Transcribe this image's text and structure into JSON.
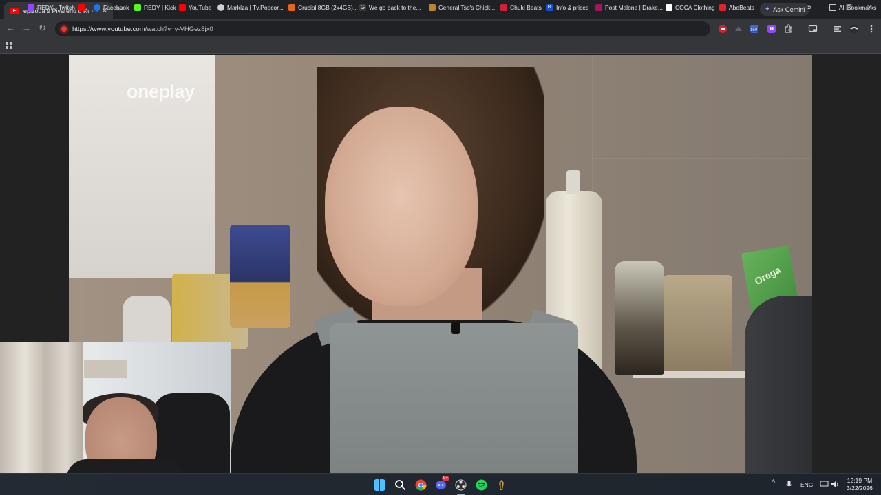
{
  "browser": {
    "tab": {
      "title": "epizóda 9 Piváreňu u Kultúr",
      "close": "✕"
    },
    "new_tab": "+",
    "ask_gemini": "Ask Gemini",
    "window_controls": {
      "minimize": "—",
      "restore": "❐",
      "close": "✕"
    },
    "nav": {
      "back": "←",
      "forward": "→",
      "reload": "↻"
    },
    "url_host": "https://www.youtube.com",
    "url_path": "/watch?v=y-VHGez8jx0",
    "extension_badge": "150"
  },
  "bookmarks": {
    "items": [
      {
        "label": "REDY - Twitch",
        "color": "#9146ff"
      },
      {
        "label": "",
        "color": "#ff0000"
      },
      {
        "label": "Facebook",
        "color": "#1877f2"
      },
      {
        "label": "REDY | Kick",
        "color": "#53fc18"
      },
      {
        "label": "YouTube",
        "color": "#ff0000"
      },
      {
        "label": "Markíza | Tv.Popcor...",
        "color": "#cfcfcf"
      },
      {
        "label": "Crucial 8GB (2x4GB)...",
        "color": "#e8641b"
      },
      {
        "label": "We go back to the...",
        "color": "#3a3a3a"
      },
      {
        "label": "General Tso's Chick...",
        "color": "#b8862c"
      },
      {
        "label": "Chuki Beats",
        "color": "#d11f3a"
      },
      {
        "label": "Info & prices",
        "color": "#1a4fd1"
      },
      {
        "label": "Post Malone | Drake...",
        "color": "#a6145f"
      },
      {
        "label": "COCA Clothing",
        "color": "#ffffff"
      },
      {
        "label": "AbeBeats",
        "color": "#e5222b"
      }
    ],
    "more": "»",
    "all_bookmarks": "All Bookmarks"
  },
  "video": {
    "watermark": "oneplay",
    "package_text": "Orega"
  },
  "taskbar": {
    "discord_badge": "9+",
    "language": "ENG",
    "time": "12:19 PM",
    "date": "3/22/2026",
    "tray_chevron": "^"
  },
  "colors": {
    "accent_red": "#ff0000",
    "tab_bg": "#35363a",
    "frame_bg": "#202124"
  }
}
